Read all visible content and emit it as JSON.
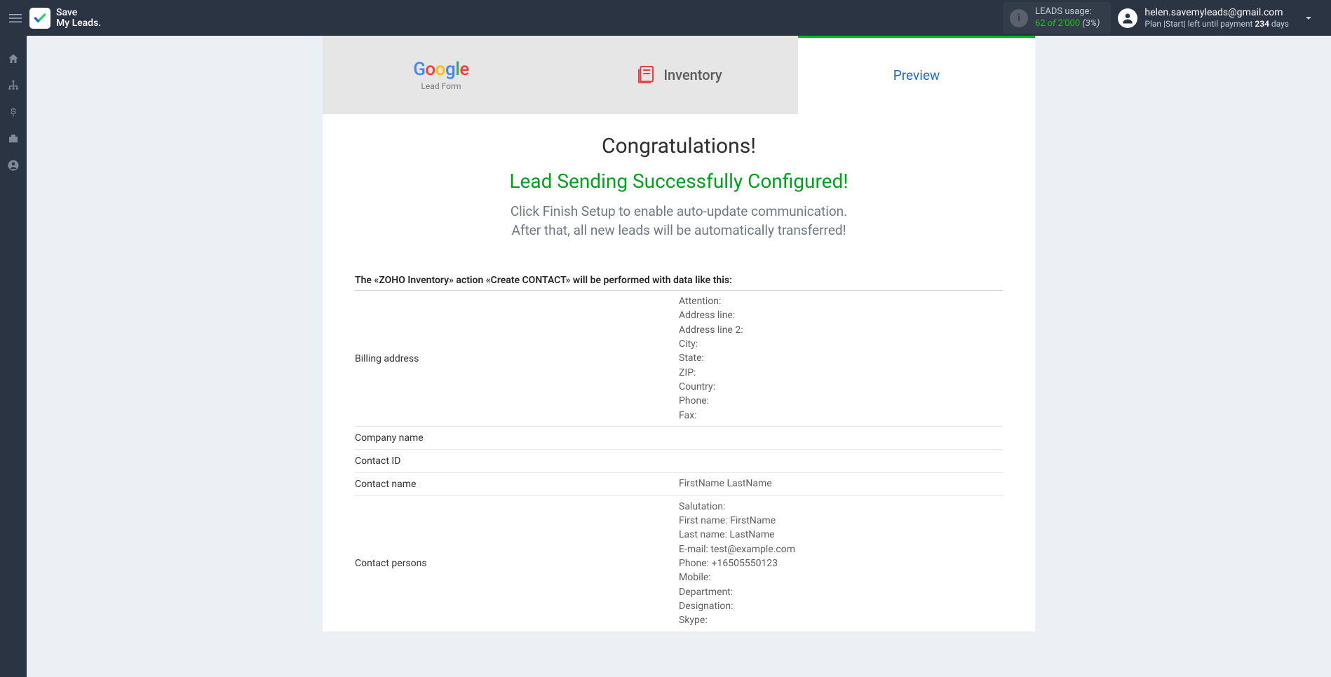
{
  "header": {
    "logo_line1": "Save",
    "logo_line2": "My Leads.",
    "leads_usage_label": "LEADS usage:",
    "leads_used": "62",
    "leads_of": "of",
    "leads_total": "2'000",
    "leads_pct": "(3%)",
    "account_email": "helen.savemyleads@gmail.com",
    "plan_prefix": "Plan |",
    "plan_name": "Start",
    "plan_mid": "| left until payment ",
    "plan_days": "234",
    "plan_suffix": " days"
  },
  "tabs": {
    "source_sub": "Lead Form",
    "destination_label": "Inventory",
    "preview_label": "Preview"
  },
  "main": {
    "congrats": "Congratulations!",
    "success": "Lead Sending Successfully Configured!",
    "instruction1": "Click Finish Setup to enable auto-update communication.",
    "instruction2": "After that, all new leads will be automatically transferred!",
    "action_intro": "The «ZOHO Inventory» action «Create CONTACT» will be performed with data like this:"
  },
  "rows": [
    {
      "label": "Billing address",
      "value": "Attention:\nAddress line:\nAddress line 2:\nCity:\nState:\nZIP:\nCountry:\nPhone:\nFax:"
    },
    {
      "label": "Company name",
      "value": ""
    },
    {
      "label": "Contact ID",
      "value": ""
    },
    {
      "label": "Contact name",
      "value": "FirstName LastName"
    },
    {
      "label": "Contact persons",
      "value": "Salutation:\nFirst name: FirstName\nLast name: LastName\nE-mail: test@example.com\nPhone: +16505550123\nMobile:\nDepartment:\nDesignation:\nSkype:"
    }
  ]
}
